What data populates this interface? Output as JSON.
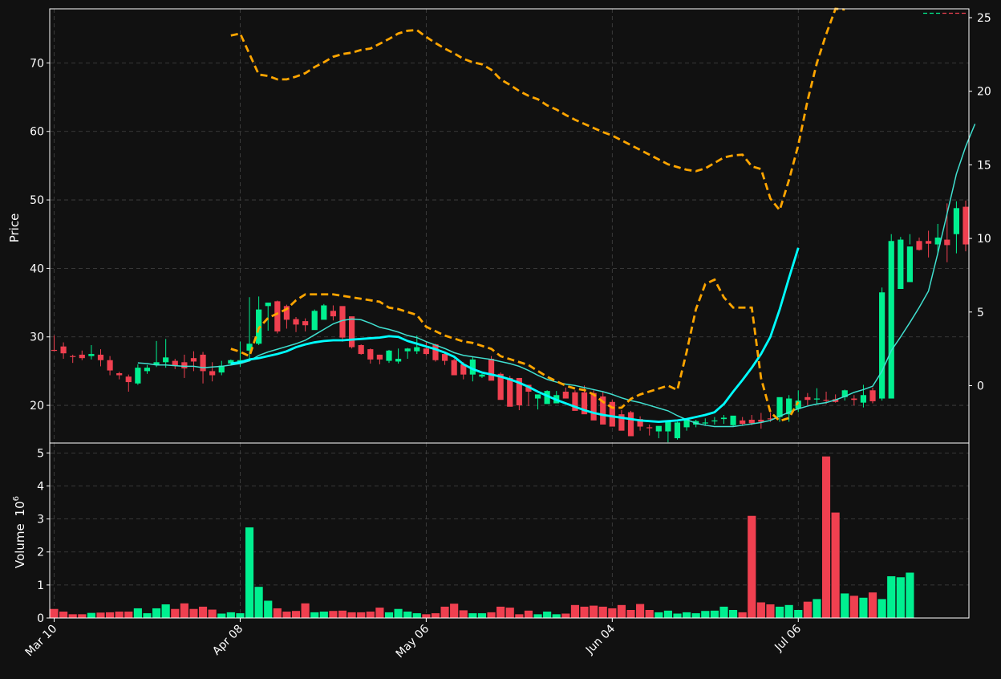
{
  "chart_data": {
    "type": "candlestick",
    "ylabel": "Price",
    "volume_label": "Volume",
    "volume_exponent": "10",
    "volume_exponent_power": "6",
    "x_tick_labels": [
      "Mar 10",
      "Apr 08",
      "May 06",
      "Jun 04",
      "Jul 06"
    ],
    "price_ticks": [
      "20",
      "30",
      "40",
      "50",
      "60",
      "70"
    ],
    "right_axis_ticks": [
      "0",
      "5",
      "10",
      "15",
      "20",
      "25"
    ],
    "volume_ticks": [
      "0",
      "1",
      "2",
      "3",
      "4",
      "5"
    ],
    "price_range": [
      14.5,
      77.9
    ],
    "right_axis_range": [
      -3.9,
      25.6
    ],
    "volume_range": [
      0,
      5.3
    ],
    "grid": true,
    "colors": {
      "background": "#111111",
      "up": "#00f090",
      "down": "#f04050",
      "ma_fast": "#40e0d0",
      "ma_slow": "#00ffff",
      "bands": "#ffa500",
      "grid": "#444444",
      "axis": "#ffffff"
    },
    "ohlcv": {
      "open": [
        28.1,
        28.6,
        27.2,
        27.4,
        27.2,
        27.4,
        26.6,
        24.7,
        24.2,
        23.2,
        25.0,
        25.9,
        26.3,
        26.5,
        26.3,
        26.9,
        27.4,
        25.0,
        24.8,
        26.1,
        26.4,
        28.0,
        29.0,
        34.5,
        35.2,
        34.5,
        32.6,
        32.3,
        31.0,
        32.5,
        33.8,
        34.5,
        33.0,
        28.8,
        28.2,
        27.4,
        26.5,
        26.4,
        27.9,
        27.9,
        28.3,
        28.9,
        27.5,
        26.6,
        26.0,
        24.5,
        24.2,
        26.8,
        24.6,
        24.0,
        24.0,
        23.0,
        21.0,
        20.2,
        20.3,
        22.0,
        21.9,
        21.9,
        21.8,
        21.3,
        20.5,
        18.7,
        19.0,
        18.0,
        16.8,
        16.2,
        16.2,
        15.2,
        16.8,
        17.2,
        17.5,
        17.8,
        18.0,
        17.1,
        17.8,
        17.9,
        17.9,
        18.1,
        18.3,
        18.7,
        19.5,
        21.2,
        21.0,
        20.8,
        20.9,
        21.2,
        21.0,
        20.4,
        22.2,
        21.0,
        21.0,
        37.0,
        38.0,
        44.0,
        44.0,
        43.5,
        44.2,
        45.0,
        49.0
      ],
      "high": [
        30.2,
        29.2,
        27.4,
        28.0,
        28.8,
        28.2,
        27.2,
        24.9,
        24.5,
        26.0,
        25.9,
        29.4,
        29.7,
        26.8,
        27.4,
        27.9,
        27.8,
        26.3,
        26.5,
        26.7,
        29.3,
        35.8,
        35.9,
        35.0,
        35.3,
        34.7,
        32.9,
        32.7,
        34.0,
        34.8,
        34.6,
        34.2,
        30.5,
        28.9,
        28.3,
        27.4,
        28.1,
        28.3,
        28.4,
        30.2,
        29.2,
        29.0,
        27.7,
        26.8,
        26.3,
        27.1,
        24.6,
        27.2,
        24.8,
        24.3,
        23.3,
        22.2,
        21.2,
        22.2,
        22.1,
        22.6,
        22.2,
        22.9,
        22.2,
        22.0,
        20.8,
        19.3,
        19.2,
        18.4,
        17.2,
        16.7,
        17.1,
        17.6,
        17.6,
        17.9,
        18.1,
        18.3,
        18.6,
        18.0,
        18.3,
        18.6,
        18.9,
        19.0,
        19.2,
        21.5,
        22.2,
        21.8,
        22.5,
        22.0,
        21.6,
        22.3,
        21.5,
        23.0,
        22.6,
        37.2,
        45.0,
        44.6,
        45.0,
        44.5,
        45.5,
        46.5,
        49.5,
        49.8,
        49.9
      ],
      "low": [
        27.9,
        26.8,
        26.2,
        26.6,
        26.7,
        25.7,
        24.4,
        23.8,
        22.0,
        23.0,
        24.6,
        25.6,
        25.5,
        25.3,
        24.0,
        25.0,
        23.2,
        23.5,
        24.4,
        25.8,
        25.6,
        26.4,
        28.8,
        30.9,
        30.5,
        31.2,
        30.7,
        30.8,
        31.8,
        33.3,
        32.4,
        29.3,
        28.3,
        27.4,
        26.1,
        26.0,
        26.2,
        26.1,
        26.8,
        27.5,
        27.3,
        26.4,
        25.9,
        25.3,
        23.8,
        23.5,
        24.0,
        24.0,
        23.4,
        19.9,
        19.3,
        19.9,
        19.4,
        20.5,
        21.3,
        21.4,
        21.2,
        21.1,
        20.3,
        18.6,
        18.2,
        18.6,
        17.3,
        16.3,
        15.6,
        15.2,
        14.6,
        15.0,
        16.3,
        16.8,
        17.0,
        17.2,
        17.3,
        16.9,
        17.0,
        17.1,
        16.6,
        17.6,
        17.6,
        17.6,
        19.0,
        20.0,
        20.2,
        20.2,
        20.4,
        20.7,
        20.0,
        19.7,
        20.3,
        20.7,
        36.7,
        37.2,
        43.5,
        42.6,
        41.6,
        42.3,
        40.9,
        42.2,
        42.5
      ],
      "close": [
        28.0,
        27.6,
        27.1,
        26.9,
        27.5,
        26.6,
        25.1,
        24.4,
        23.4,
        25.5,
        25.5,
        26.3,
        27.0,
        25.8,
        25.4,
        26.4,
        25.0,
        24.4,
        25.8,
        26.6,
        26.6,
        29.0,
        34.0,
        35.0,
        30.8,
        32.5,
        31.8,
        31.7,
        33.8,
        34.6,
        33.0,
        29.9,
        28.5,
        27.5,
        26.7,
        26.7,
        28.0,
        26.8,
        28.3,
        28.5,
        27.5,
        26.6,
        26.5,
        24.4,
        24.5,
        26.7,
        24.5,
        23.6,
        20.8,
        19.8,
        20.0,
        22.0,
        21.6,
        22.1,
        21.5,
        21.0,
        19.2,
        18.7,
        17.8,
        17.2,
        16.9,
        16.3,
        15.5,
        16.9,
        16.7,
        17.0,
        17.6,
        17.5,
        17.9,
        17.7,
        17.5,
        17.8,
        18.2,
        18.5,
        17.3,
        17.4,
        17.6,
        18.0,
        21.2,
        21.0,
        20.7,
        20.8,
        21.0,
        20.7,
        20.5,
        22.2,
        20.8,
        21.5,
        20.6,
        36.5,
        44.0,
        44.2,
        43.2,
        42.7,
        43.6,
        44.5,
        43.4,
        48.8,
        43.5
      ],
      "volume": [
        0.28,
        0.2,
        0.12,
        0.12,
        0.16,
        0.17,
        0.18,
        0.2,
        0.2,
        0.3,
        0.15,
        0.3,
        0.42,
        0.28,
        0.45,
        0.28,
        0.35,
        0.26,
        0.14,
        0.18,
        0.15,
        2.75,
        0.95,
        0.53,
        0.3,
        0.2,
        0.22,
        0.45,
        0.18,
        0.2,
        0.22,
        0.23,
        0.18,
        0.18,
        0.2,
        0.32,
        0.18,
        0.28,
        0.2,
        0.15,
        0.12,
        0.15,
        0.35,
        0.44,
        0.24,
        0.15,
        0.15,
        0.18,
        0.35,
        0.32,
        0.12,
        0.23,
        0.12,
        0.2,
        0.12,
        0.14,
        0.4,
        0.35,
        0.38,
        0.35,
        0.3,
        0.4,
        0.25,
        0.43,
        0.25,
        0.18,
        0.23,
        0.14,
        0.18,
        0.15,
        0.22,
        0.23,
        0.35,
        0.25,
        0.18,
        3.1,
        0.48,
        0.42,
        0.35,
        0.4,
        0.25,
        0.5,
        0.58,
        4.9,
        3.2,
        0.75,
        0.68,
        0.62,
        0.78,
        0.58,
        1.27,
        1.24,
        1.38
      ]
    },
    "ma_fast": [
      null,
      null,
      null,
      null,
      null,
      null,
      null,
      null,
      null,
      26.2,
      26.1,
      25.9,
      25.9,
      25.8,
      25.7,
      25.7,
      25.5,
      25.6,
      25.7,
      25.9,
      26.1,
      26.5,
      27.3,
      27.8,
      28.2,
      28.6,
      29.0,
      29.5,
      30.3,
      31.1,
      31.9,
      32.4,
      32.6,
      32.5,
      32.0,
      31.4,
      31.1,
      30.7,
      30.2,
      29.9,
      29.3,
      28.8,
      28.3,
      27.7,
      27.3,
      27.1,
      26.9,
      26.7,
      26.4,
      26.1,
      25.7,
      25.1,
      24.4,
      23.8,
      23.4,
      23.1,
      22.9,
      22.6,
      22.3,
      22.0,
      21.6,
      21.1,
      20.7,
      20.4,
      20.0,
      19.6,
      19.2,
      18.5,
      17.9,
      17.4,
      17.1,
      16.9,
      16.9,
      16.9,
      17.1,
      17.3,
      17.5,
      17.8,
      18.4,
      19.0,
      19.5,
      19.9,
      20.2,
      20.4,
      20.8,
      21.3,
      21.9,
      22.3,
      22.8,
      25.0,
      28.0,
      30.0,
      32.1,
      34.3,
      36.7,
      42.2,
      48.0,
      53.8,
      57.8,
      61.1
    ],
    "ma_slow": [
      null,
      null,
      null,
      null,
      null,
      null,
      null,
      null,
      null,
      null,
      null,
      null,
      null,
      null,
      null,
      null,
      null,
      null,
      null,
      26.1,
      26.3,
      26.7,
      26.9,
      27.2,
      27.5,
      27.9,
      28.5,
      28.9,
      29.2,
      29.4,
      29.5,
      29.5,
      29.6,
      29.7,
      29.8,
      29.9,
      30.1,
      30.0,
      29.4,
      29.0,
      28.6,
      28.2,
      27.7,
      27.1,
      26.0,
      25.3,
      24.8,
      24.5,
      24.2,
      23.8,
      23.3,
      22.7,
      22.0,
      21.4,
      20.8,
      20.3,
      19.8,
      19.3,
      18.9,
      18.6,
      18.4,
      18.2,
      18.0,
      17.8,
      17.7,
      17.6,
      17.7,
      17.8,
      18.0,
      18.3,
      18.6,
      19.0,
      20.2,
      22.0,
      23.7,
      25.5,
      27.5,
      30.0,
      34.0,
      38.6,
      43.0
    ],
    "bands": {
      "upper": [
        null,
        null,
        null,
        null,
        null,
        null,
        null,
        null,
        null,
        null,
        null,
        null,
        null,
        null,
        null,
        null,
        null,
        null,
        null,
        74.0,
        74.3,
        71.3,
        68.3,
        68.1,
        67.6,
        67.6,
        68.0,
        68.5,
        69.4,
        70.1,
        70.9,
        71.3,
        71.5,
        71.9,
        72.1,
        72.8,
        73.5,
        74.3,
        74.7,
        74.8,
        73.8,
        72.9,
        72.1,
        71.4,
        70.6,
        70.1,
        69.8,
        69.0,
        67.6,
        66.8,
        65.9,
        65.2,
        64.7,
        63.8,
        63.2,
        62.4,
        61.7,
        61.1,
        60.5,
        59.9,
        59.4,
        58.7,
        58.0,
        57.3,
        56.6,
        55.9,
        55.2,
        54.8,
        54.4,
        54.2,
        54.6,
        55.4,
        56.2,
        56.5,
        56.6,
        54.9,
        54.5,
        50.2,
        48.5,
        52.9,
        58.0,
        64.5,
        70.0,
        74.2,
        77.9,
        77.8
      ],
      "lower": [
        null,
        null,
        null,
        null,
        null,
        null,
        null,
        null,
        null,
        null,
        null,
        null,
        null,
        null,
        null,
        null,
        null,
        null,
        null,
        2.5,
        2.3,
        2.0,
        3.9,
        4.6,
        4.9,
        5.2,
        5.8,
        6.2,
        6.2,
        6.2,
        6.2,
        6.1,
        6.0,
        5.9,
        5.8,
        5.7,
        5.3,
        5.2,
        5.0,
        4.8,
        4.0,
        3.7,
        3.4,
        3.2,
        3.0,
        2.9,
        2.7,
        2.5,
        2.0,
        1.8,
        1.6,
        1.4,
        1.0,
        0.6,
        0.3,
        0.0,
        -0.2,
        -0.3,
        -0.6,
        -1.1,
        -1.5,
        -1.5,
        -0.9,
        -0.6,
        -0.4,
        -0.2,
        0.0,
        -0.3,
        2.3,
        5.2,
        6.9,
        7.2,
        6.0,
        5.3,
        5.3,
        5.3,
        0.5,
        -1.8,
        -2.4,
        -2.2,
        -1.1
      ]
    }
  }
}
